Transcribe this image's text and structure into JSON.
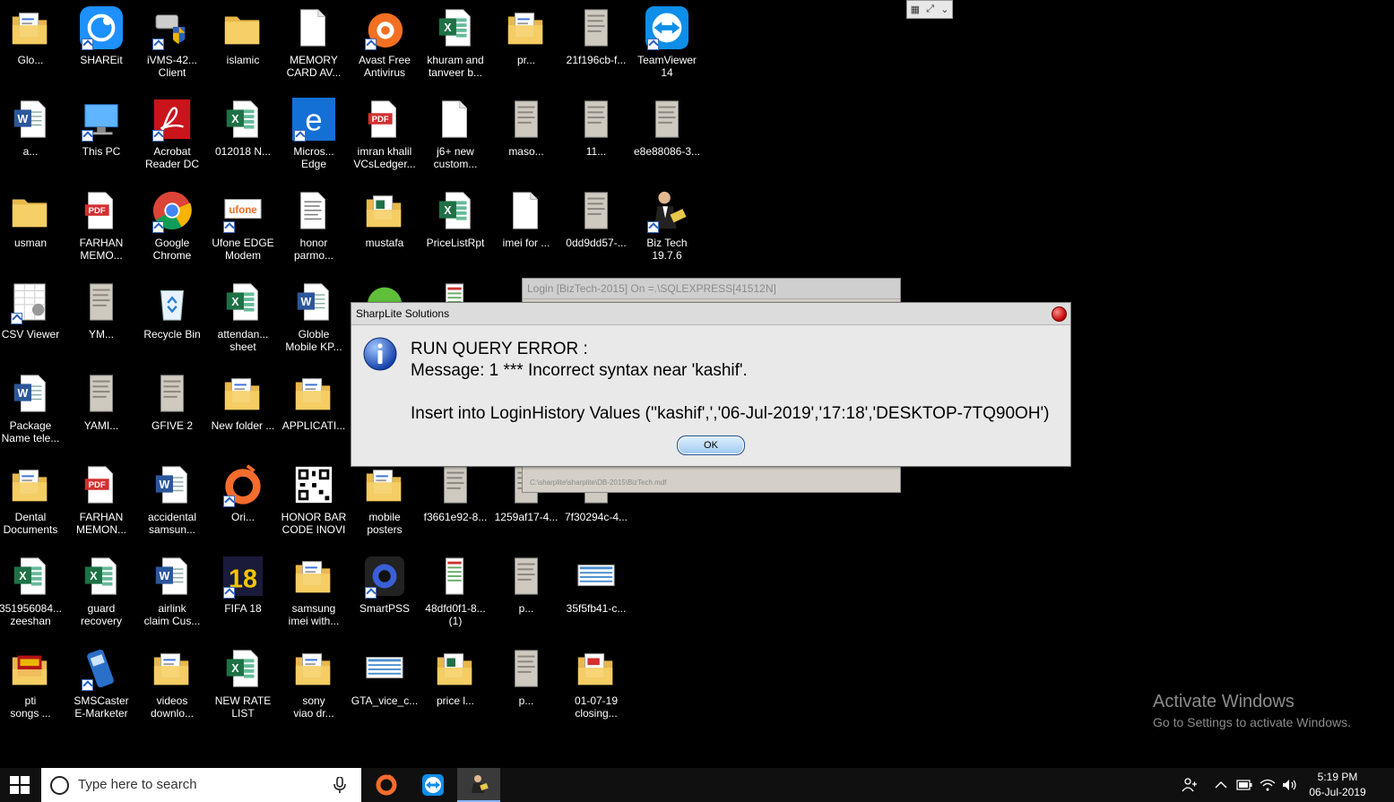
{
  "mini_toolbar": {
    "icons": [
      "grid-icon",
      "expand-icon",
      "chevron-down-icon"
    ]
  },
  "desktop_icons": [
    {
      "label": "Glo...",
      "icon": "folder-doc",
      "shortcut": false
    },
    {
      "label": "SHAREit",
      "icon": "shareit",
      "shortcut": true
    },
    {
      "label": "iVMS-42...\nClient",
      "icon": "camera-shield",
      "shortcut": true
    },
    {
      "label": "islamic",
      "icon": "folder",
      "shortcut": false
    },
    {
      "label": "MEMORY\nCARD AV...",
      "icon": "blank-doc",
      "shortcut": false
    },
    {
      "label": "Avast Free\nAntivirus",
      "icon": "avast",
      "shortcut": true
    },
    {
      "label": "khuram and\ntanveer b...",
      "icon": "excel",
      "shortcut": false
    },
    {
      "label": "pr...",
      "icon": "folder-doc",
      "shortcut": false
    },
    {
      "label": "21f196cb-f...",
      "icon": "photo",
      "shortcut": false
    },
    {
      "label": "TeamViewer\n14",
      "icon": "teamviewer",
      "shortcut": true
    },
    {
      "label": "a...",
      "icon": "word",
      "shortcut": false
    },
    {
      "label": "This PC",
      "icon": "pc",
      "shortcut": true
    },
    {
      "label": "Acrobat\nReader DC",
      "icon": "acrobat",
      "shortcut": true
    },
    {
      "label": "012018 N...",
      "icon": "excel",
      "shortcut": false
    },
    {
      "label": "Micros...\nEdge",
      "icon": "edge",
      "shortcut": true
    },
    {
      "label": "imran khalil\nVCsLedger...",
      "icon": "pdf",
      "shortcut": false
    },
    {
      "label": "j6+ new\ncustom...",
      "icon": "blank-doc",
      "shortcut": false
    },
    {
      "label": "maso...",
      "icon": "photo",
      "shortcut": false
    },
    {
      "label": "11...",
      "icon": "photo",
      "shortcut": false
    },
    {
      "label": "e8e88086-3...",
      "icon": "photo",
      "shortcut": false
    },
    {
      "label": "usman",
      "icon": "folder",
      "shortcut": false
    },
    {
      "label": "FARHAN\nMEMO...",
      "icon": "pdf",
      "shortcut": false
    },
    {
      "label": "Google\nChrome",
      "icon": "chrome",
      "shortcut": true
    },
    {
      "label": "Ufone EDGE\nModem",
      "icon": "ufone",
      "shortcut": true
    },
    {
      "label": "honor\nparmo...",
      "icon": "doc-lines",
      "shortcut": false
    },
    {
      "label": "mustafa",
      "icon": "folder-excel",
      "shortcut": false
    },
    {
      "label": "PriceListRpt",
      "icon": "excel",
      "shortcut": false
    },
    {
      "label": "imei for ...",
      "icon": "blank-doc",
      "shortcut": false
    },
    {
      "label": "0dd9dd57-...",
      "icon": "photo",
      "shortcut": false
    },
    {
      "label": "Biz Tech\n19.7.6",
      "icon": "biztech",
      "shortcut": true
    },
    {
      "label": "CSV Viewer",
      "icon": "csv",
      "shortcut": true
    },
    {
      "label": "YM...",
      "icon": "photo",
      "shortcut": false
    },
    {
      "label": "Recycle Bin",
      "icon": "recycle",
      "shortcut": false
    },
    {
      "label": "attendan...\nsheet",
      "icon": "excel",
      "shortcut": false
    },
    {
      "label": "Globle\nMobile KP...",
      "icon": "word",
      "shortcut": false
    },
    {
      "label": "",
      "icon": "green-round",
      "shortcut": false
    },
    {
      "label": "",
      "icon": "red-doc",
      "shortcut": false
    },
    {
      "label": "Package\nName tele...",
      "icon": "word",
      "shortcut": false
    },
    {
      "label": "YAMI...",
      "icon": "photo",
      "shortcut": false
    },
    {
      "label": "GFIVE 2",
      "icon": "photo",
      "shortcut": false
    },
    {
      "label": "New folder ...",
      "icon": "folder-doc",
      "shortcut": false
    },
    {
      "label": "APPLICATI...",
      "icon": "folder-doc",
      "shortcut": false
    },
    {
      "label": "Dental\nDocuments",
      "icon": "folder-doc",
      "shortcut": false
    },
    {
      "label": "FARHAN\nMEMON...",
      "icon": "pdf",
      "shortcut": false
    },
    {
      "label": "accidental\nsamsun...",
      "icon": "word",
      "shortcut": false
    },
    {
      "label": "Ori...",
      "icon": "origin",
      "shortcut": true
    },
    {
      "label": "HONOR BAR\nCODE INOVI",
      "icon": "qr",
      "shortcut": false
    },
    {
      "label": "mobile\nposters",
      "icon": "folder-doc",
      "shortcut": false
    },
    {
      "label": "f3661e92-8...",
      "icon": "photo",
      "shortcut": false
    },
    {
      "label": "1259af17-4...",
      "icon": "photo",
      "shortcut": false
    },
    {
      "label": "7f30294c-4...",
      "icon": "photo",
      "shortcut": false
    },
    {
      "label": "351956084...\nzeeshan",
      "icon": "excel",
      "shortcut": false
    },
    {
      "label": "guard\nrecovery",
      "icon": "excel",
      "shortcut": false
    },
    {
      "label": "airlink\nclaim Cus...",
      "icon": "word",
      "shortcut": false
    },
    {
      "label": "FIFA 18",
      "icon": "fifa",
      "shortcut": true
    },
    {
      "label": "samsung\nimei with...",
      "icon": "folder-doc",
      "shortcut": false
    },
    {
      "label": "SmartPSS",
      "icon": "smartpss",
      "shortcut": true
    },
    {
      "label": "48dfd0f1-8...\n(1)",
      "icon": "red-doc",
      "shortcut": false
    },
    {
      "label": "p...",
      "icon": "photo",
      "shortcut": false
    },
    {
      "label": "35f5fb41-c...",
      "icon": "sheet-img",
      "shortcut": false
    },
    {
      "label": "pti\nsongs ...",
      "icon": "folder-pti",
      "shortcut": false
    },
    {
      "label": "SMSCaster\nE-Marketer",
      "icon": "phone",
      "shortcut": true
    },
    {
      "label": "videos\ndownlo...",
      "icon": "folder-doc",
      "shortcut": false
    },
    {
      "label": "NEW RATE\nLIST",
      "icon": "excel",
      "shortcut": false
    },
    {
      "label": "sony\nviao dr...",
      "icon": "folder-doc",
      "shortcut": false
    },
    {
      "label": "GTA_vice_c...",
      "icon": "sheet-img",
      "shortcut": false
    },
    {
      "label": "price l...",
      "icon": "folder-excel",
      "shortcut": false
    },
    {
      "label": "p...",
      "icon": "photo",
      "shortcut": false
    },
    {
      "label": "01-07-19\nclosing...",
      "icon": "folder-pdf",
      "shortcut": false
    }
  ],
  "bg_window": {
    "title": "Login [BizTech-2015]  On =.\\SQLEXPRESS[41512N]",
    "path": "C:\\sharplite\\sharplite\\DB-2015\\BizTech.mdf"
  },
  "dialog": {
    "title": "SharpLite Solutions",
    "line1": "RUN QUERY ERROR :",
    "line2": "Message: 1 *** Incorrect syntax near 'kashif'.",
    "line3": "Insert into LoginHistory Values (''kashif',','06-Jul-2019','17:18','DESKTOP-7TQ90OH')",
    "ok_label": "OK"
  },
  "watermark": {
    "title": "Activate Windows",
    "subtitle": "Go to Settings to activate Windows."
  },
  "taskbar": {
    "search_placeholder": "Type here to search",
    "apps": [
      "origin-icon",
      "teamviewer-icon",
      "biztech-icon"
    ],
    "tray_icons": [
      "people-icon",
      "chevron-up-icon",
      "battery-icon",
      "wifi-icon",
      "volume-icon"
    ],
    "time": "5:19 PM",
    "date": "06-Jul-2019"
  }
}
